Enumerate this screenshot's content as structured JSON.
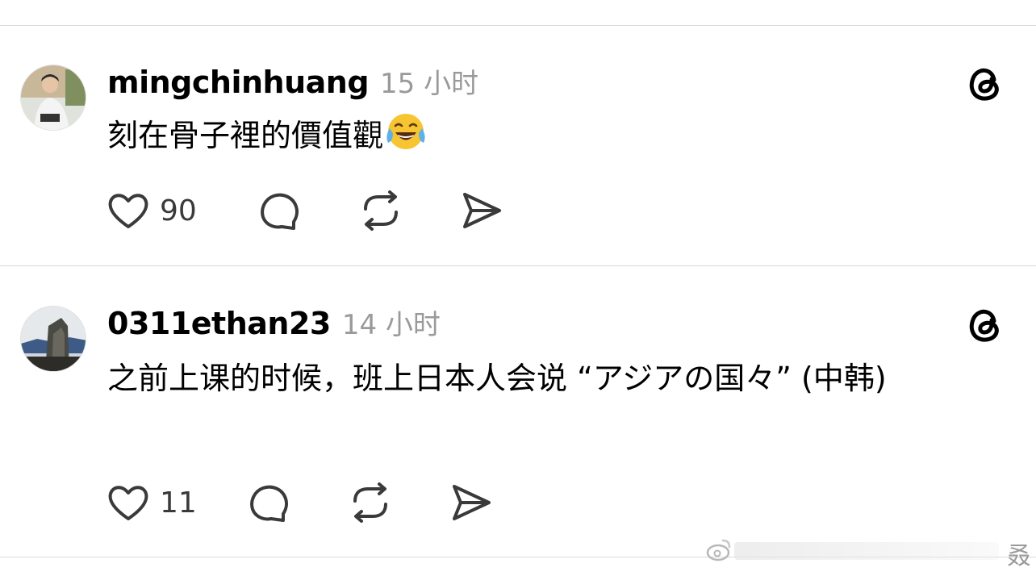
{
  "posts": [
    {
      "username": "mingchinhuang",
      "time": "15 小时",
      "text": "刻在骨子裡的價值觀",
      "emoji": "face-with-tears-of-joy",
      "likes": "90",
      "avatar": "avatar-person-photo"
    },
    {
      "username": "0311ethan23",
      "time": "14 小时",
      "text": "之前上课的时候，班上日本人会说 “アジアの国々” (中韩)",
      "likes": "11",
      "avatar": "avatar-building-photo"
    }
  ],
  "icons": {
    "logo": "threads-logo-icon",
    "like": "heart-icon",
    "reply": "comment-bubble-icon",
    "repost": "repost-icon",
    "share": "send-icon"
  },
  "watermark": {
    "char": "叒"
  },
  "colors": {
    "text": "#000000",
    "muted": "#9a9a9a",
    "icon": "#3a3a3a",
    "divider": "#d9d9d9",
    "emoji": "#f6c531"
  }
}
